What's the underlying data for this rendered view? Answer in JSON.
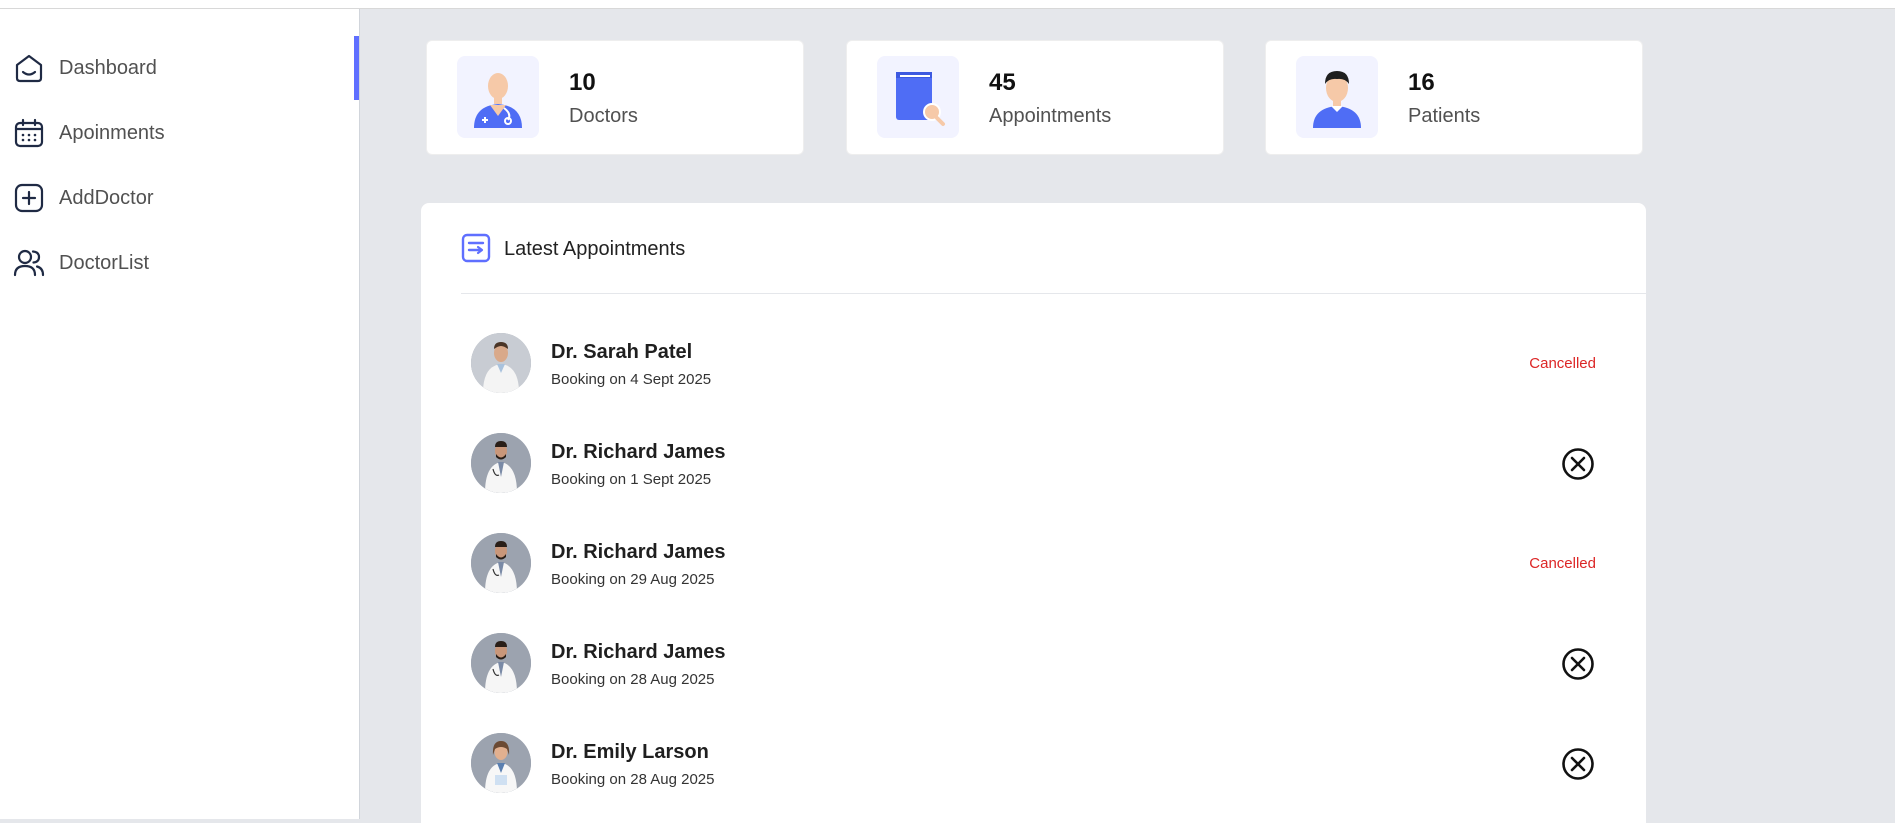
{
  "sidebar": {
    "items": [
      {
        "label": "Dashboard",
        "icon": "home-icon",
        "active": true
      },
      {
        "label": "Apoinments",
        "icon": "calendar-icon",
        "active": false
      },
      {
        "label": "AddDoctor",
        "icon": "add-square-icon",
        "active": false
      },
      {
        "label": "DoctorList",
        "icon": "people-icon",
        "active": false
      }
    ]
  },
  "stats": [
    {
      "count": "10",
      "label": "Doctors",
      "icon": "doctor-icon"
    },
    {
      "count": "45",
      "label": "Appointments",
      "icon": "appointments-book-icon"
    },
    {
      "count": "16",
      "label": "Patients",
      "icon": "patient-icon"
    }
  ],
  "latest": {
    "title": "Latest Appointments",
    "icon": "list-icon",
    "rows": [
      {
        "name": "Dr. Sarah Patel",
        "date": "Booking on 4 Sept 2025",
        "status": "Cancelled"
      },
      {
        "name": "Dr. Richard James",
        "date": "Booking on 1 Sept 2025",
        "status": "cancel-action"
      },
      {
        "name": "Dr. Richard James",
        "date": "Booking on 29 Aug 2025",
        "status": "Cancelled"
      },
      {
        "name": "Dr. Richard James",
        "date": "Booking on 28 Aug 2025",
        "status": "cancel-action"
      },
      {
        "name": "Dr. Emily Larson",
        "date": "Booking on 28 Aug 2025",
        "status": "cancel-action"
      }
    ]
  },
  "colors": {
    "accent": "#5f6fff",
    "cancelled": "#dc2626",
    "background": "#e5e7eb"
  }
}
